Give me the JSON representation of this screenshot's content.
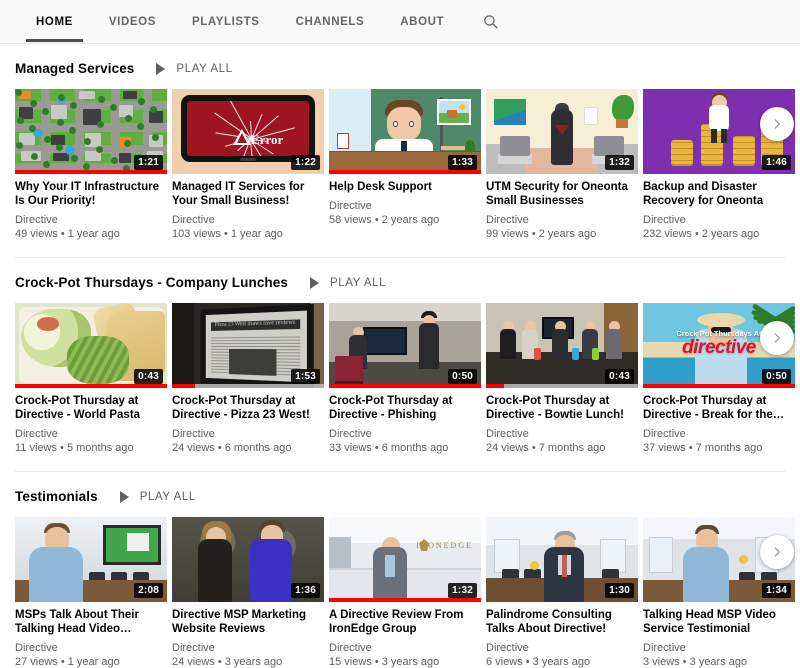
{
  "tabs": [
    {
      "label": "HOME",
      "active": true
    },
    {
      "label": "VIDEOS",
      "active": false
    },
    {
      "label": "PLAYLISTS",
      "active": false
    },
    {
      "label": "CHANNELS",
      "active": false
    },
    {
      "label": "ABOUT",
      "active": false
    }
  ],
  "search_icon": "search-icon",
  "next_icon": "chevron-right-icon",
  "play_all_label": "PLAY ALL",
  "accent_color": "#ff0000",
  "shelves": [
    {
      "title": "Managed Services",
      "videos": [
        {
          "title": "Why Your IT Infrastructure Is Our Priority!",
          "owner": "Directive",
          "stats": "49 views • 1 year ago",
          "duration": "1:21",
          "progress": 100,
          "art": "city"
        },
        {
          "title": "Managed IT Services for Your Small Business!",
          "owner": "Directive",
          "stats": "103 views • 1 year ago",
          "duration": "1:22",
          "progress": 0,
          "art": "err"
        },
        {
          "title": "Help Desk Support",
          "owner": "Directive",
          "stats": "58 views • 2 years ago",
          "duration": "1:33",
          "progress": 100,
          "art": "hd"
        },
        {
          "title": "UTM Security for Oneonta Small Businesses",
          "owner": "Directive",
          "stats": "99 views • 2 years ago",
          "duration": "1:32",
          "progress": 0,
          "art": "utm"
        },
        {
          "title": "Backup and Disaster Recovery for Oneonta Small…",
          "owner": "Directive",
          "stats": "232 views • 2 years ago",
          "duration": "1:46",
          "progress": 0,
          "art": "coin"
        }
      ]
    },
    {
      "title": "Crock-Pot Thursdays - Company Lunches",
      "videos": [
        {
          "title": "Crock-Pot Thursday at Directive - World Pasta Day!",
          "owner": "Directive",
          "stats": "11 views • 5 months ago",
          "duration": "0:43",
          "progress": 100,
          "art": "pasta"
        },
        {
          "title": "Crock-Pot Thursday at Directive - Pizza 23 West!",
          "owner": "Directive",
          "stats": "24 views • 6 months ago",
          "duration": "1:53",
          "progress": 15,
          "art": "news"
        },
        {
          "title": "Crock-Pot Thursday at Directive - Phishing Lessons",
          "owner": "Directive",
          "stats": "33 views • 6 months ago",
          "duration": "0:50",
          "progress": 100,
          "art": "phish"
        },
        {
          "title": "Crock-Pot Thursday at Directive - Bowtie Lunch!",
          "owner": "Directive",
          "stats": "24 views • 7 months ago",
          "duration": "0:43",
          "progress": 12,
          "art": "bow"
        },
        {
          "title": "Crock-Pot Thursday at Directive - Break for the…",
          "owner": "Directive",
          "stats": "37 views • 7 months ago",
          "duration": "0:50",
          "progress": 100,
          "art": "beach"
        }
      ]
    },
    {
      "title": "Testimonials",
      "videos": [
        {
          "title": "MSPs Talk About Their Talking Head Video…",
          "owner": "Directive",
          "stats": "27 views • 1 year ago",
          "duration": "2:08",
          "progress": 0,
          "art": "msp"
        },
        {
          "title": "Directive MSP Marketing Website Reviews (Mashup)",
          "owner": "Directive",
          "stats": "24 views • 3 years ago",
          "duration": "1:36",
          "progress": 0,
          "art": "rock"
        },
        {
          "title": "A Directive Review From IronEdge Group",
          "owner": "Directive",
          "stats": "15 views • 3 years ago",
          "duration": "1:32",
          "progress": 100,
          "art": "lob"
        },
        {
          "title": "Palindrome Consulting Talks About Directive!",
          "owner": "Directive",
          "stats": "6 views • 3 years ago",
          "duration": "1:30",
          "progress": 0,
          "art": "pal"
        },
        {
          "title": "Talking Head MSP Video Service Testimonial",
          "owner": "Directive",
          "stats": "3 views • 3 years ago",
          "duration": "1:34",
          "progress": 0,
          "art": "th"
        }
      ]
    }
  ],
  "thumbnail_text": {
    "beach_line1": "Crock Pot Thursdays At",
    "beach_line2": "directive",
    "error_text": "Error",
    "news_headline": "Pizza 23 West draws rave reviews",
    "ironedge_sign": "IRONEDGE"
  }
}
